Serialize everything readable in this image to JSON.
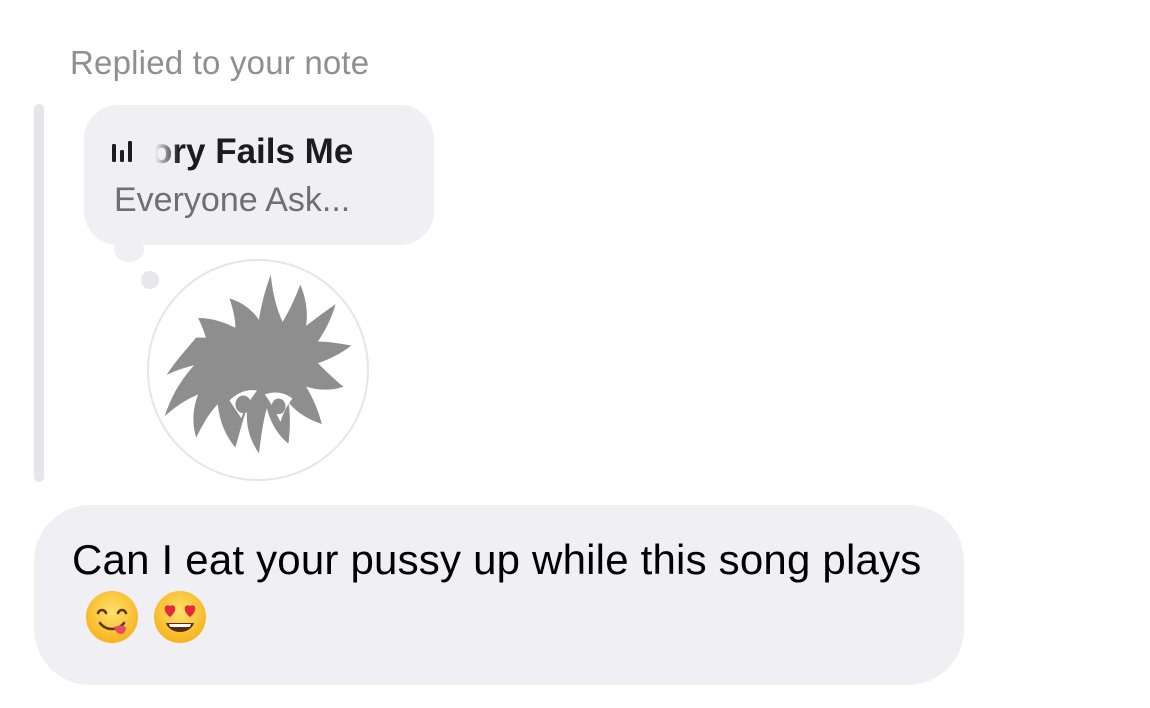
{
  "reply_header": {
    "label": "Replied to your note"
  },
  "note": {
    "icon": "audio-waveform-icon",
    "title": "ory Fails Me",
    "subtitle": "Everyone Ask..."
  },
  "avatar": {
    "icon": "anime-character-avatar"
  },
  "message": {
    "text": "Can I eat your pussy up while this song plays",
    "emojis": [
      "face-savoring-food-emoji",
      "heart-eyes-emoji"
    ]
  },
  "colors": {
    "bubble": "#f0f0f4",
    "label": "#8e8e93",
    "note_subtitle": "#6e6e73",
    "avatar_art": "#8e8e8e"
  }
}
